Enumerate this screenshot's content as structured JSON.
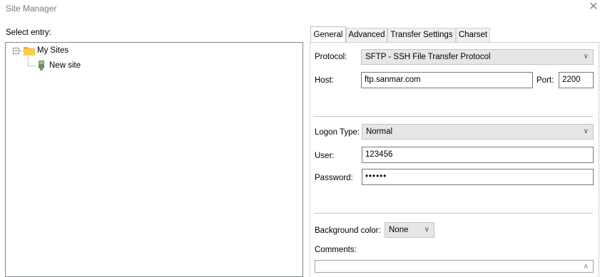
{
  "window": {
    "title": "Site Manager",
    "close_glyph": "✕"
  },
  "left": {
    "label": "Select entry:",
    "tree": [
      {
        "label": "My Sites",
        "icon": "folder-icon",
        "expander": "−"
      },
      {
        "label": "New site",
        "icon": "site-icon"
      }
    ]
  },
  "tabs": [
    "General",
    "Advanced",
    "Transfer Settings",
    "Charset"
  ],
  "general": {
    "protocol_label": "Protocol:",
    "protocol_value": "SFTP - SSH File Transfer Protocol",
    "host_label": "Host:",
    "host_value": "ftp.sanmar.com",
    "port_label": "Port:",
    "port_value": "2200",
    "logon_type_label": "Logon Type:",
    "logon_type_value": "Normal",
    "user_label": "User:",
    "user_value": "123456",
    "password_label": "Password:",
    "password_value": "••••••",
    "bg_color_label": "Background color:",
    "bg_color_value": "None",
    "comments_label": "Comments:"
  },
  "colors": {
    "folder": "#f5b429",
    "site": "#6b8f5a",
    "select_bg": "#e6e6e6"
  }
}
